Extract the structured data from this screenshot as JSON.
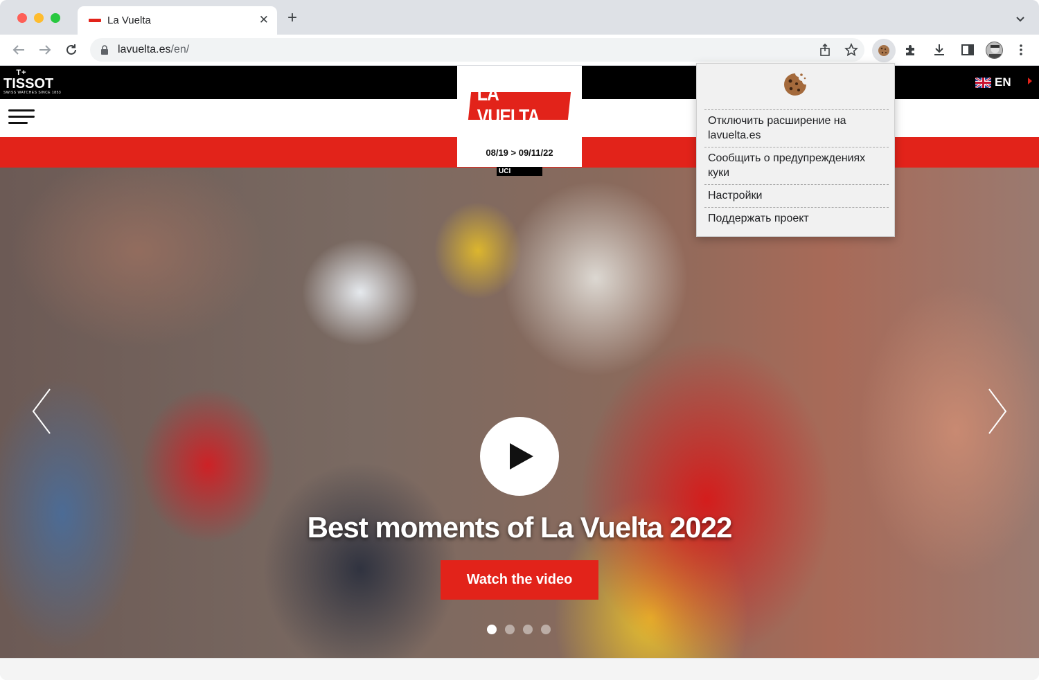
{
  "browser": {
    "tab": {
      "title": "La Vuelta"
    },
    "address": {
      "host": "lavuelta.es",
      "path": "/en/"
    }
  },
  "site": {
    "sponsor": {
      "line1": "T+",
      "name": "TISSOT",
      "tagline": "SWISS WATCHES SINCE 1853"
    },
    "language": {
      "label": "EN"
    },
    "logo": {
      "text": "LA VUELTA",
      "dates": "08/19 > 09/11/22",
      "badge": "UCI"
    },
    "hero": {
      "title": "Best moments of La Vuelta 2022",
      "cta_label": "Watch the video",
      "slides": [
        true,
        false,
        false,
        false
      ]
    }
  },
  "extension_popup": {
    "items": [
      "Отключить расширение на lavuelta.es",
      "Сообщить о предупреждениях куки",
      "Настройки",
      "Поддержать проект"
    ]
  },
  "colors": {
    "brand_red": "#e2231a",
    "chrome_bg": "#dee1e6"
  }
}
